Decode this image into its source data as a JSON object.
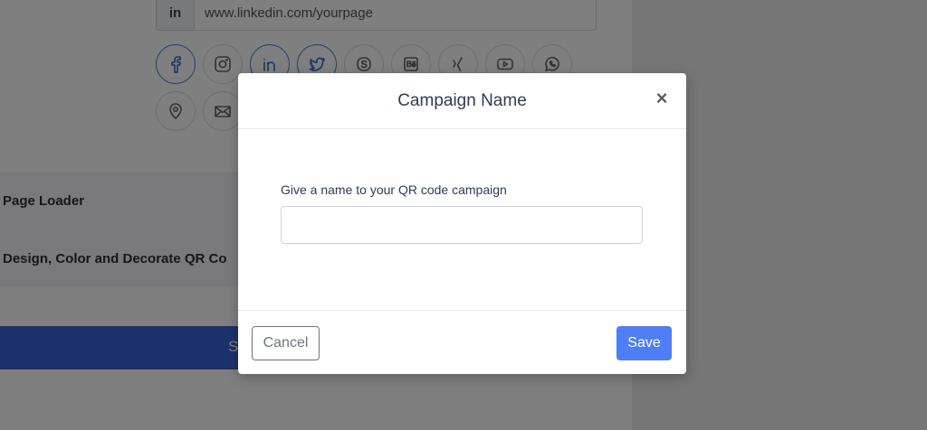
{
  "background": {
    "url_field": {
      "prefix_icon": "linkedin-icon",
      "prefix_text": "in",
      "value": "www.linkedin.com/yourpage"
    },
    "social_icons_row1": [
      "facebook-icon",
      "instagram-icon",
      "linkedin-icon",
      "twitter-icon",
      "skype-icon",
      "behance-icon",
      "xing-icon",
      "youtube-icon",
      "whatsapp-icon"
    ],
    "social_icons_row2": [
      "location-icon",
      "email-icon"
    ],
    "sections": {
      "page_loader": "Page Loader",
      "design_color": "Design, Color and Decorate QR Co"
    },
    "primary_button_fragment": "S"
  },
  "modal": {
    "title": "Campaign Name",
    "close_label": "×",
    "field_label": "Give a name to your QR code campaign",
    "input_value": "",
    "cancel_label": "Cancel",
    "save_label": "Save"
  },
  "colors": {
    "accent": "#4f7df5",
    "primary_bar": "#3b63d8",
    "title_text": "#2e3b55",
    "active_icon": "#3466d6"
  }
}
